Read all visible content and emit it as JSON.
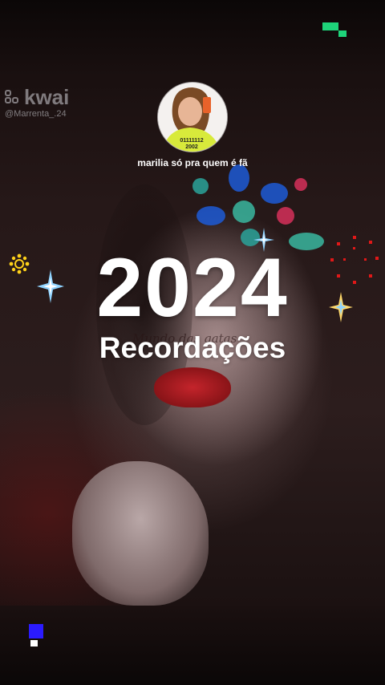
{
  "watermark": {
    "brand": "kwai",
    "username": "@Marrenta_.24"
  },
  "profile": {
    "caption": "marilia  só pra quem é fã"
  },
  "overlay": {
    "year": "2024",
    "subtitle": "Recordações",
    "ghost_text": "Mundo das gatas"
  },
  "colors": {
    "accent_green": "#1ed47a",
    "lips_red": "#c4242b",
    "sparkle_blue": "#8fd3ff",
    "deco_blue": "#2b1bff",
    "deco_yellow": "#ffd21a",
    "deco_red": "#e01818"
  }
}
